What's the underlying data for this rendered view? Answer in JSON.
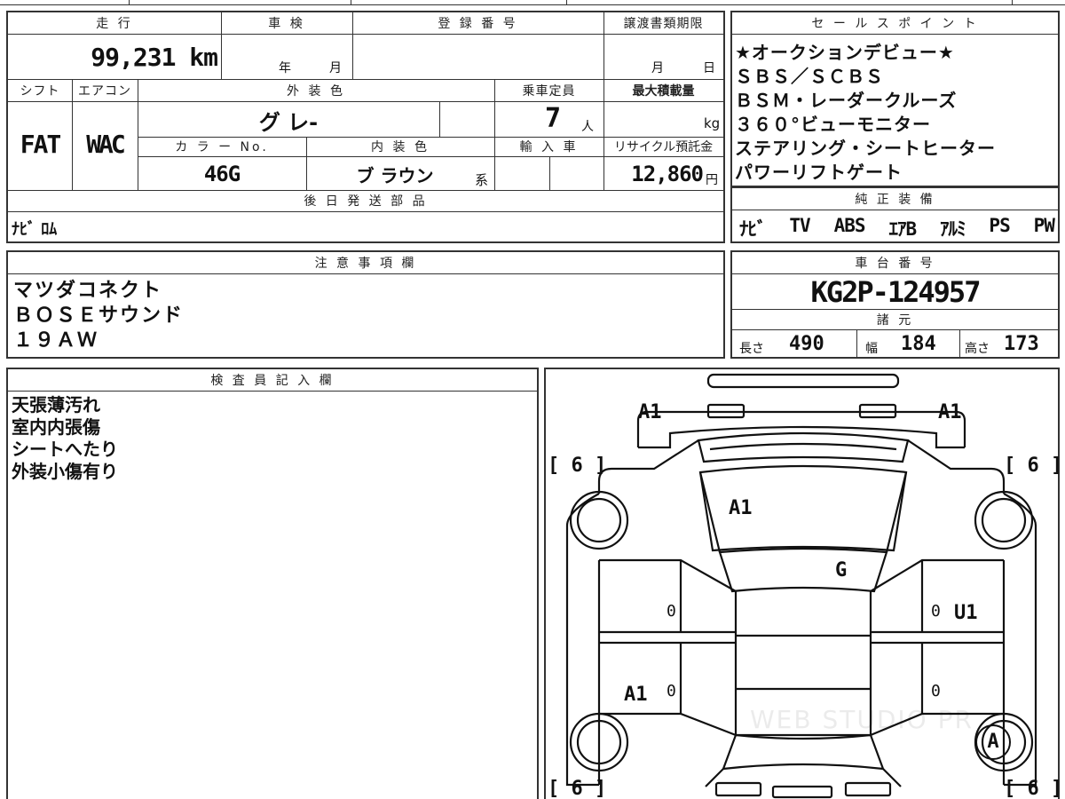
{
  "top_strip": {
    "partial_text_1": "",
    "partial_text_2": ""
  },
  "vehicle": {
    "mileage_label": "走 行",
    "mileage_value": "99,231 km",
    "inspection_label": "車 検",
    "inspection_year_unit": "年",
    "inspection_month_unit": "月",
    "registration_label": "登 録 番 号",
    "transfer_label": "譲渡書類期限",
    "transfer_month_unit": "月",
    "transfer_day_unit": "日",
    "shift_label": "シフト",
    "shift_value": "FAT",
    "aircon_label": "エアコン",
    "aircon_value": "WAC",
    "exterior_color_label": "外 装 色",
    "exterior_color_value": "グ レ-",
    "capacity_label": "乗車定員",
    "capacity_value": "7",
    "capacity_unit": "人",
    "max_load_label": "最大積載量",
    "max_load_unit": "kg",
    "color_no_label": "カ ラ ー No.",
    "color_no_value": "46G",
    "interior_color_label": "内 装 色",
    "interior_color_value": "ブ ラウン",
    "interior_color_suffix": "系",
    "import_label": "輸 入 車",
    "recycle_label": "リサイクル預託金",
    "recycle_value": "12,860",
    "recycle_unit": "円",
    "later_parts_label": "後 日 発 送 部 品",
    "later_parts_value": "ﾅﾋﾞ ﾛﾑ"
  },
  "sales_points": {
    "label": "セ ー ル ス ポ イ ン ト",
    "lines": [
      "★オークションデビュー★",
      "ＳＢＳ／ＳＣＢＳ",
      "ＢＳＭ・レーダークルーズ",
      "３６０°ビューモニター",
      "ステアリング・シートヒーター",
      "パワーリフトゲート"
    ]
  },
  "genuine_equipment": {
    "label": "純 正 装 備",
    "items": [
      "ﾅﾋﾞ",
      "TV",
      "ABS",
      "ｴｱB",
      "ｱﾙﾐ",
      "PS",
      "PW"
    ]
  },
  "notes": {
    "label": "注 意 事 項 欄",
    "lines": [
      "マツダコネクト",
      "ＢＯＳＥサウンド",
      "１９ＡＷ"
    ]
  },
  "chassis": {
    "label": "車 台 番 号",
    "value": "KG2P-124957",
    "specs_label": "諸 元",
    "length_label": "長さ",
    "length_value": "490",
    "width_label": "幅",
    "width_value": "184",
    "height_label": "高さ",
    "height_value": "173"
  },
  "inspector": {
    "label": "検 査 員 記 入 欄",
    "lines": [
      "天張薄汚れ",
      "室内内張傷",
      "シートへたり",
      "外装小傷有り"
    ]
  },
  "diagram": {
    "marks": {
      "front_left": "A1",
      "front_right": "A1",
      "hood": "A1",
      "windshield": "G",
      "right_door": "U1",
      "left_rear": "A1",
      "right_rear_wheel": "A",
      "left_front_door_num": "0",
      "right_front_door_num": "0",
      "left_rear_door_num": "0",
      "right_rear_door_num": "0"
    },
    "tires": {
      "fl": "[ 6 ]",
      "fr": "[ 6 ]",
      "rl": "[ 6 ]",
      "rr": "[ 6 ]"
    },
    "watermark": "WEB STUDIO PR"
  }
}
